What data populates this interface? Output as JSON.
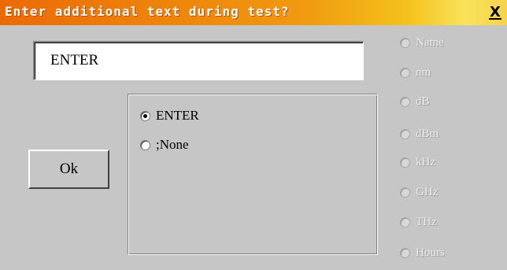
{
  "window": {
    "title": "Enter additional text during test?",
    "close_glyph": "X"
  },
  "text_field": {
    "value": "ENTER"
  },
  "ok_button": {
    "label": "Ok"
  },
  "options": [
    {
      "label": "ENTER",
      "selected": true
    },
    {
      "label": ";None",
      "selected": false
    }
  ],
  "units": [
    {
      "label": "Name",
      "enabled": false
    },
    {
      "label": "nm",
      "enabled": false
    },
    {
      "label": "dB",
      "enabled": false
    },
    {
      "label": "dBm",
      "enabled": false
    },
    {
      "label": "kHz",
      "enabled": false
    },
    {
      "label": "GHz",
      "enabled": false
    },
    {
      "label": "THz",
      "enabled": false
    },
    {
      "label": "Hours",
      "enabled": false
    }
  ]
}
